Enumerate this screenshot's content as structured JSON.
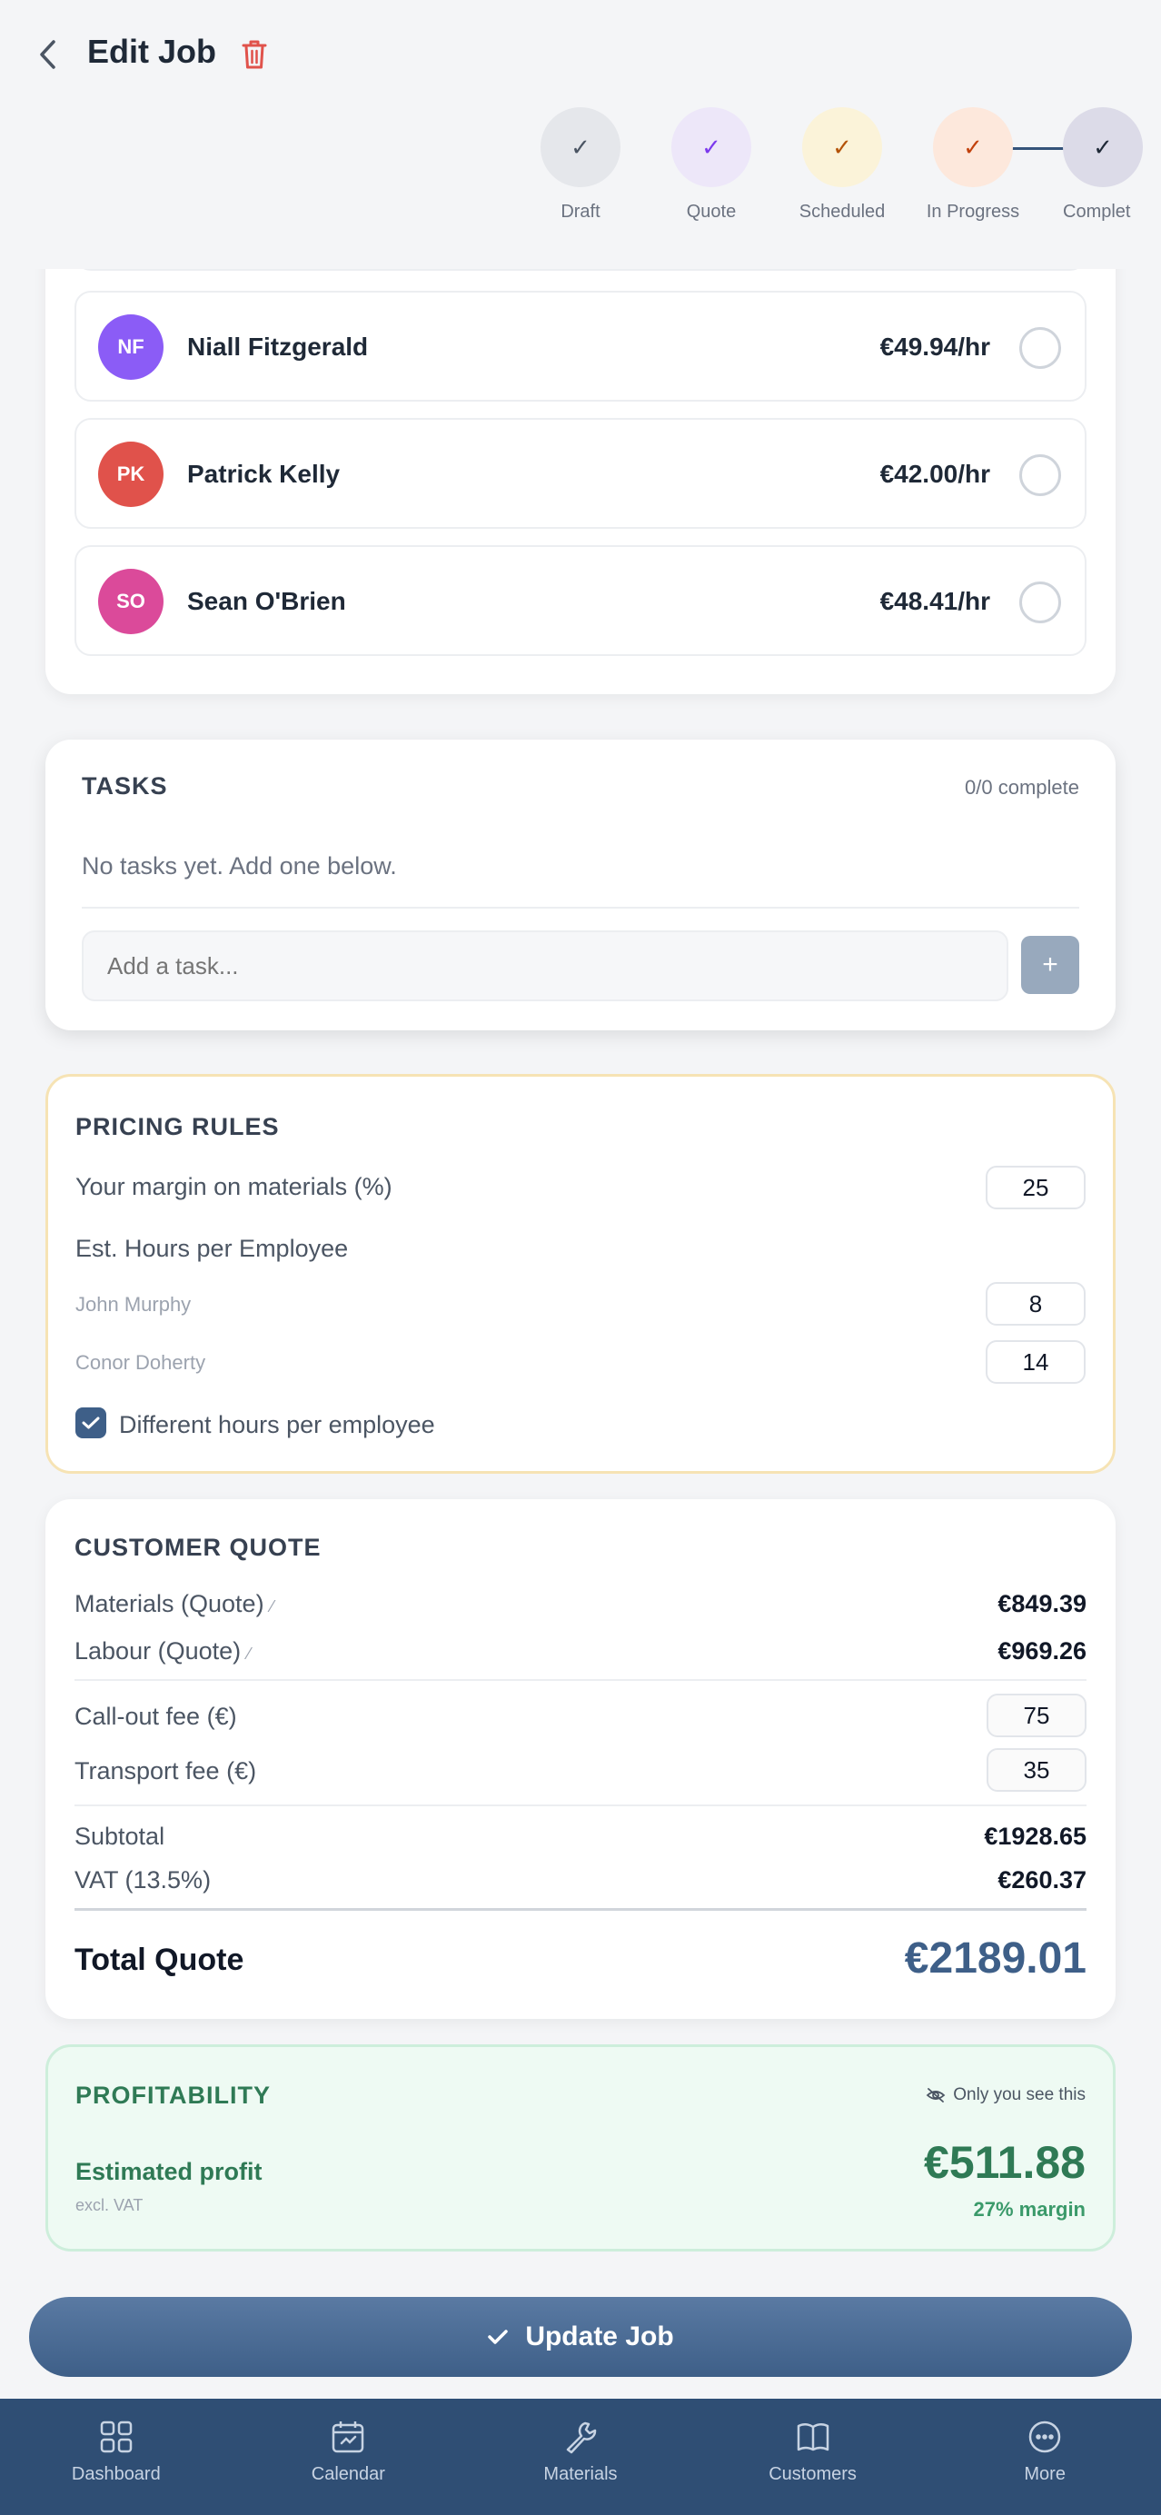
{
  "header": {
    "title": "Edit Job",
    "steps": [
      {
        "label": "Draft",
        "bg": "#e5e7eb",
        "check": "#4b5563"
      },
      {
        "label": "Quote",
        "bg": "#ede7f9",
        "check": "#7c3aed"
      },
      {
        "label": "Scheduled",
        "bg": "#fbf3d9",
        "check": "#b45309"
      },
      {
        "label": "In Progress",
        "bg": "#fde8dc",
        "check": "#c2410c"
      },
      {
        "label": "Complet",
        "bg": "#dcdbe8",
        "check": "#1f2937"
      }
    ]
  },
  "employees": [
    {
      "initials": "NF",
      "name": "Niall Fitzgerald",
      "rate": "€49.94/hr",
      "color": "#8b5cf6"
    },
    {
      "initials": "PK",
      "name": "Patrick Kelly",
      "rate": "€42.00/hr",
      "color": "#e0524b"
    },
    {
      "initials": "SO",
      "name": "Sean O'Brien",
      "rate": "€48.41/hr",
      "color": "#db4a9a"
    }
  ],
  "tasks": {
    "title": "TASKS",
    "progress": "0/0 complete",
    "empty_text": "No tasks yet. Add one below.",
    "input_placeholder": "Add a task...",
    "add_symbol": "+"
  },
  "pricing": {
    "title": "PRICING RULES",
    "margin_label": "Your margin on materials (%)",
    "margin_value": "25",
    "hours_label": "Est. Hours per Employee",
    "hours": [
      {
        "name": "John Murphy",
        "value": "8"
      },
      {
        "name": "Conor Doherty",
        "value": "14"
      }
    ],
    "different_hours_label": "Different hours per employee"
  },
  "quote": {
    "title": "CUSTOMER QUOTE",
    "materials_label": "Materials (Quote)",
    "materials_value": "€849.39",
    "labour_label": "Labour (Quote)",
    "labour_value": "€969.26",
    "callout_label": "Call-out fee (€)",
    "callout_value": "75",
    "transport_label": "Transport fee (€)",
    "transport_value": "35",
    "subtotal_label": "Subtotal",
    "subtotal_value": "€1928.65",
    "vat_label": "VAT (13.5%)",
    "vat_value": "€260.37",
    "total_label": "Total Quote",
    "total_value": "€2189.01"
  },
  "profit": {
    "title": "PROFITABILITY",
    "private_note": "Only you see this",
    "estimated_label": "Estimated profit",
    "excl_note": "excl. VAT",
    "value": "€511.88",
    "margin": "27% margin"
  },
  "update_button": "Update Job",
  "tabs": [
    {
      "label": "Dashboard",
      "icon": "dashboard-icon"
    },
    {
      "label": "Calendar",
      "icon": "calendar-icon"
    },
    {
      "label": "Materials",
      "icon": "wrench-icon"
    },
    {
      "label": "Customers",
      "icon": "book-icon"
    },
    {
      "label": "More",
      "icon": "more-icon"
    }
  ]
}
